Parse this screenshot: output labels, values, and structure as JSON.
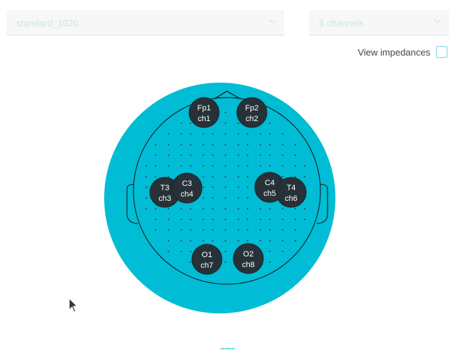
{
  "montage_select": {
    "value": "standard_1020"
  },
  "channels_select": {
    "value": "8 channels"
  },
  "impedance": {
    "label": "View impedances",
    "checked": false
  },
  "colors": {
    "head_fill": "#00bcd4",
    "electrode_fill": "#263238",
    "outline": "#111111"
  },
  "icons": {
    "select_arrow": "chevron-down-icon",
    "cursor": "mouse-pointer-icon"
  },
  "electrodes": [
    {
      "site": "Fp1",
      "channel": "ch1"
    },
    {
      "site": "Fp2",
      "channel": "ch2"
    },
    {
      "site": "T3",
      "channel": "ch3"
    },
    {
      "site": "C3",
      "channel": "ch4"
    },
    {
      "site": "C4",
      "channel": "ch5"
    },
    {
      "site": "T4",
      "channel": "ch6"
    },
    {
      "site": "O1",
      "channel": "ch7"
    },
    {
      "site": "O2",
      "channel": "ch8"
    }
  ]
}
